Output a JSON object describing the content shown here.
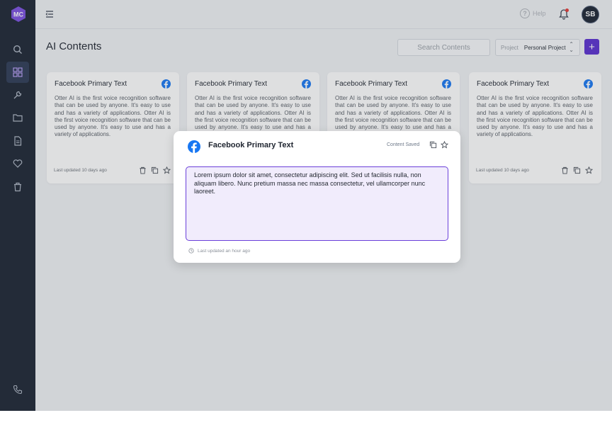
{
  "sidebar": {
    "logo": "MC",
    "items": [
      {
        "icon": "search-icon"
      },
      {
        "icon": "dashboard-icon",
        "active": true
      },
      {
        "icon": "tools-icon"
      },
      {
        "icon": "folder-icon"
      },
      {
        "icon": "document-icon"
      },
      {
        "icon": "heart-icon"
      },
      {
        "icon": "trash-icon"
      }
    ],
    "bottom_icon": "phone-icon"
  },
  "header": {
    "help_label": "Help",
    "avatar_initials": "SB"
  },
  "page": {
    "title": "AI Contents",
    "search_placeholder": "Search Contents",
    "project_label": "Project",
    "project_value": "Personal Project",
    "add_label": "+"
  },
  "cards": [
    {
      "title": "Facebook Primary Text",
      "body": "Otter AI is the first voice recognition software that can be used by anyone. It's easy to use and has a variety of applications. Otter AI is the first voice recognition software that can be used by anyone. It's easy to use and has a variety of applications.",
      "updated": "Last updated 10 days ago"
    },
    {
      "title": "Facebook Primary Text",
      "body": "Otter AI is the first voice recognition software that can be used by anyone. It's easy to use and has a variety of applications. Otter AI is the first voice recognition software that can be used by anyone. It's easy to use and has a variety of applications.",
      "updated": ""
    },
    {
      "title": "Facebook Primary Text",
      "body": "Otter AI is the first voice recognition software that can be used by anyone. It's easy to use and has a variety of applications. Otter AI is the first voice recognition software that can be used by anyone. It's easy to use and has a variety of applications.",
      "updated": ""
    },
    {
      "title": "Facebook Primary Text",
      "body": "Otter AI is the first voice recognition software that can be used by anyone. It's easy to use and has a variety of applications. Otter AI is the first voice recognition software that can be used by anyone. It's easy to use and has a variety of applications.",
      "updated": "Last updated 10 days ago"
    }
  ],
  "modal": {
    "title": "Facebook Primary Text",
    "status": "Content Saved",
    "content": "Lorem ipsum dolor sit amet, consectetur adipiscing elit. Sed ut facilisis nulla, non aliquam libero. Nunc pretium massa nec massa consectetur, vel ullamcorper nunc laoreet.",
    "updated": "Last updated an hour ago"
  },
  "colors": {
    "sidebar_bg": "#1b2433",
    "accent": "#5a2fd0",
    "facebook": "#1877f2",
    "editor_border": "#6a3fd9",
    "editor_bg": "#f1ecfc"
  }
}
